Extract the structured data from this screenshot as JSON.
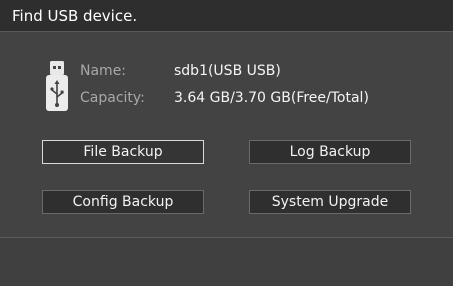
{
  "window": {
    "title": "Find USB device."
  },
  "device": {
    "icon": "usb-drive-icon",
    "name_label": "Name:",
    "name_value": "sdb1(USB USB)",
    "capacity_label": "Capacity:",
    "capacity_value": "3.64 GB/3.70 GB(Free/Total)"
  },
  "actions": {
    "file_backup": "File Backup",
    "log_backup": "Log Backup",
    "config_backup": "Config Backup",
    "system_upgrade": "System Upgrade"
  },
  "colors": {
    "background": "#434343",
    "titlebar": "#2e2e2e",
    "button": "#2f2f2f",
    "selected_border": "#d9d9d9"
  }
}
